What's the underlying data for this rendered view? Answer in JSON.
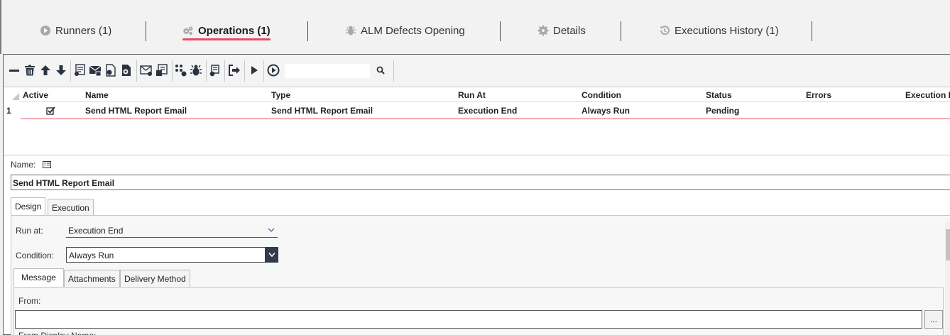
{
  "top_tabs": [
    {
      "label": "Runners (1)",
      "icon": "play-circle-icon",
      "active": false
    },
    {
      "label": "Operations (1)",
      "icon": "gears-icon",
      "active": true
    },
    {
      "label": "ALM Defects Opening",
      "icon": "bug-icon",
      "active": false
    },
    {
      "label": "Details",
      "icon": "gear-icon",
      "active": false
    },
    {
      "label": "Executions History (1)",
      "icon": "history-icon",
      "active": false
    }
  ],
  "toolbar": {
    "search_value": "",
    "icons": [
      "minus-icon",
      "delete-icon",
      "move-up-icon",
      "move-down-icon",
      "send-email-icon",
      "send-html-email-icon",
      "export-report-icon",
      "generate-report-icon",
      "email-icon",
      "save-icon",
      "alm-icon",
      "defect-icon",
      "script-icon",
      "export-icon",
      "run-icon",
      "run-all-icon",
      "search-icon"
    ]
  },
  "grid": {
    "columns": [
      "Active",
      "Name",
      "Type",
      "Run At",
      "Condition",
      "Status",
      "Errors",
      "Execution D"
    ],
    "rows": [
      {
        "num": "1",
        "active": true,
        "name": "Send HTML Report Email",
        "type": "Send HTML Report Email",
        "run_at": "Execution End",
        "condition": "Always Run",
        "status": "Pending",
        "errors": ""
      }
    ]
  },
  "detail": {
    "name_label": "Name:",
    "name_value": "Send HTML Report Email",
    "tabs": [
      "Design",
      "Execution"
    ],
    "run_at_label": "Run at:",
    "run_at_value": "Execution End",
    "condition_label": "Condition:",
    "condition_value": "Always Run",
    "sub_tabs": [
      "Message",
      "Attachments",
      "Delivery Method"
    ],
    "from_label": "From:",
    "from_value": "",
    "browse_label": "...",
    "from_display_name_label": "From Display Name:"
  },
  "colors": {
    "accent_underline": "#e84a6a",
    "row_selected_line": "#e05060",
    "dropdown_button": "#333c48"
  }
}
